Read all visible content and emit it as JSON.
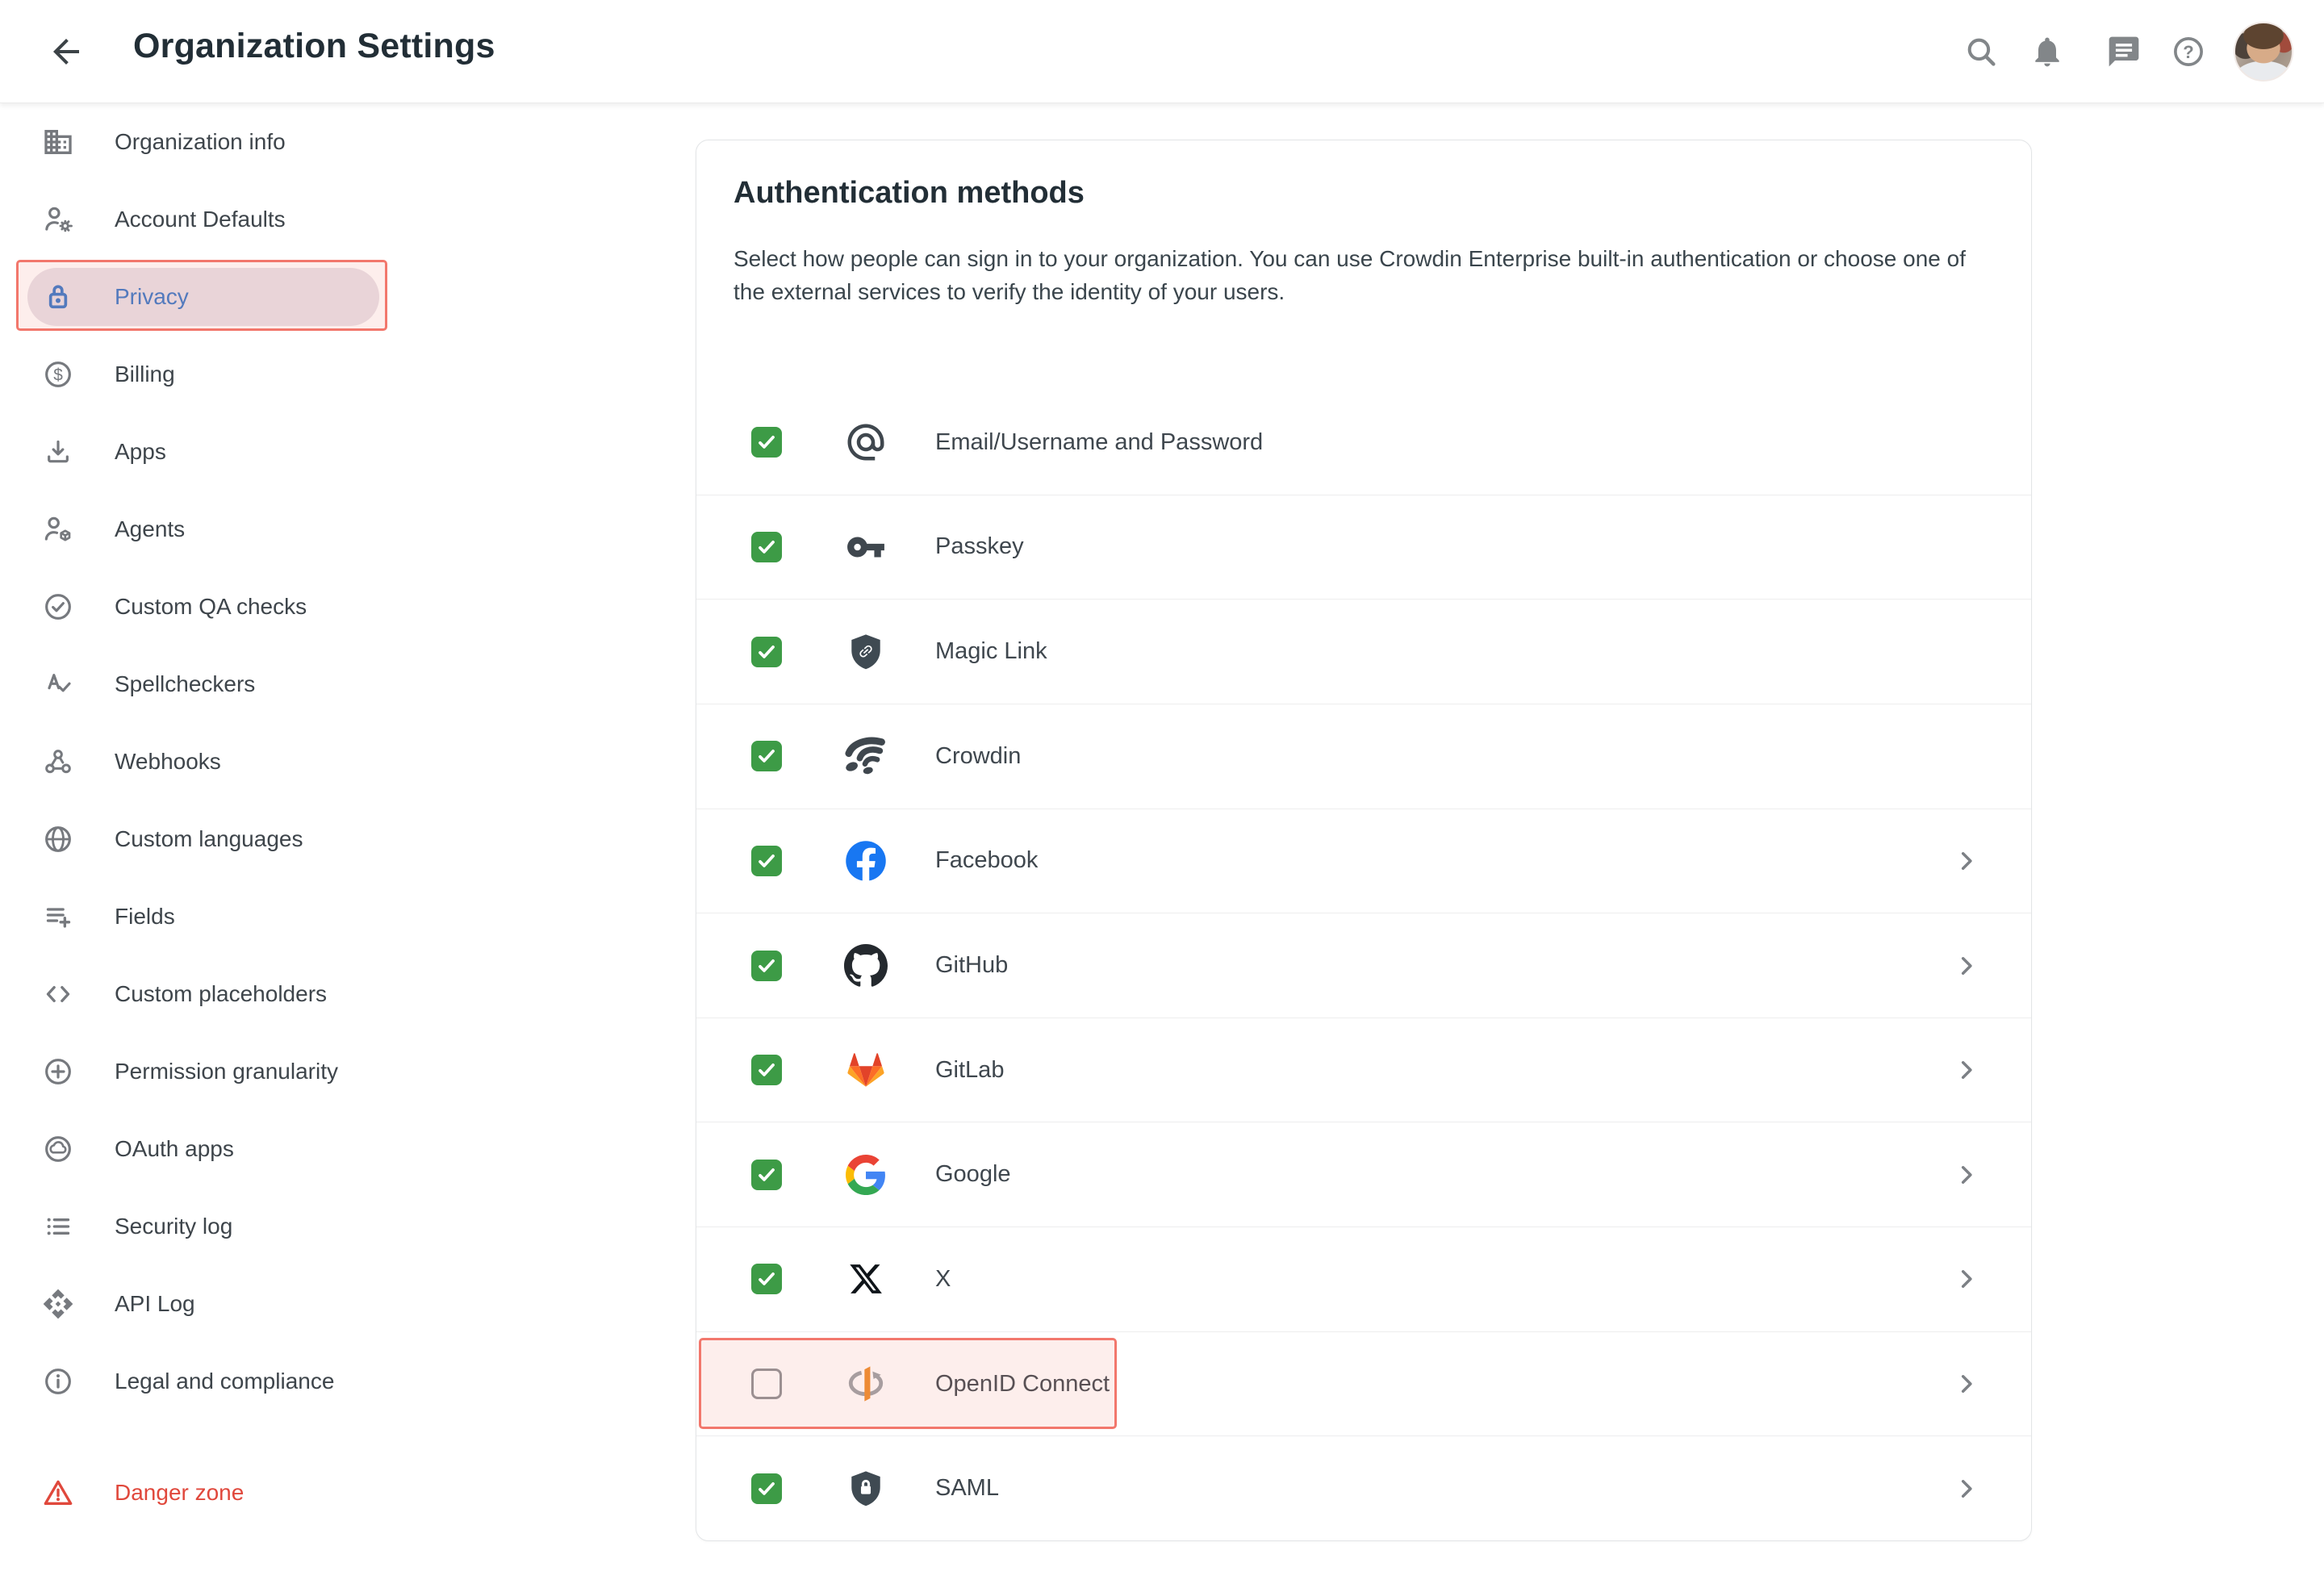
{
  "header": {
    "title": "Organization Settings",
    "icons": [
      {
        "name": "search-icon"
      },
      {
        "name": "notifications-icon"
      },
      {
        "name": "messages-icon"
      },
      {
        "name": "help-icon"
      }
    ],
    "avatar": "user-avatar"
  },
  "sidebar": {
    "items": [
      {
        "label": "Organization info",
        "icon": "building"
      },
      {
        "label": "Account Defaults",
        "icon": "person-gear"
      },
      {
        "label": "Privacy",
        "icon": "lock",
        "active": true,
        "annotated": true
      },
      {
        "label": "Billing",
        "icon": "dollar"
      },
      {
        "label": "Apps",
        "icon": "download"
      },
      {
        "label": "Agents",
        "icon": "person-cube"
      },
      {
        "label": "Custom QA checks",
        "icon": "check-circle"
      },
      {
        "label": "Spellcheckers",
        "icon": "spellcheck"
      },
      {
        "label": "Webhooks",
        "icon": "webhook"
      },
      {
        "label": "Custom languages",
        "icon": "globe"
      },
      {
        "label": "Fields",
        "icon": "fields"
      },
      {
        "label": "Custom placeholders",
        "icon": "code"
      },
      {
        "label": "Permission granularity",
        "icon": "plus-circle"
      },
      {
        "label": "OAuth apps",
        "icon": "oauth-cloud"
      },
      {
        "label": "Security log",
        "icon": "list"
      },
      {
        "label": "API Log",
        "icon": "api"
      },
      {
        "label": "Legal and compliance",
        "icon": "info"
      },
      {
        "label": "Danger zone",
        "icon": "warning",
        "danger": true
      }
    ]
  },
  "panel": {
    "title": "Authentication methods",
    "description": "Select how people can sign in to your organization. You can use Crowdin Enterprise built-in authentication or choose one of the external services to verify the identity of your users.",
    "rows": [
      {
        "label": "Email/Username and Password",
        "icon": "at",
        "checked": true,
        "chevron": false
      },
      {
        "label": "Passkey",
        "icon": "key",
        "checked": true,
        "chevron": false
      },
      {
        "label": "Magic Link",
        "icon": "shield-link",
        "checked": true,
        "chevron": false
      },
      {
        "label": "Crowdin",
        "icon": "crowdin",
        "checked": true,
        "chevron": false
      },
      {
        "label": "Facebook",
        "icon": "facebook",
        "checked": true,
        "chevron": true
      },
      {
        "label": "GitHub",
        "icon": "github",
        "checked": true,
        "chevron": true
      },
      {
        "label": "GitLab",
        "icon": "gitlab",
        "checked": true,
        "chevron": true
      },
      {
        "label": "Google",
        "icon": "google",
        "checked": true,
        "chevron": true
      },
      {
        "label": "X",
        "icon": "x",
        "checked": true,
        "chevron": true
      },
      {
        "label": "OpenID Connect",
        "icon": "openid",
        "checked": false,
        "chevron": true,
        "highlighted": true
      },
      {
        "label": "SAML",
        "icon": "shield-lock",
        "checked": true,
        "chevron": true
      }
    ]
  },
  "colors": {
    "checkbox_green": "#3D9B46",
    "active_blue": "#3A78C9",
    "danger_red": "#E0483C",
    "highlight_border": "#F2776C",
    "highlight_fill": "rgba(243,132,122,0.14)"
  }
}
